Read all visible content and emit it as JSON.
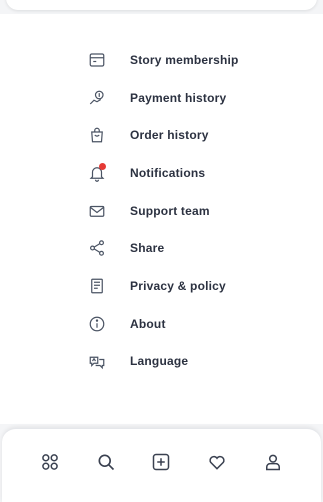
{
  "menu": {
    "items": [
      {
        "label": "Story membership",
        "icon": "membership-card-icon"
      },
      {
        "label": "Payment history",
        "icon": "payment-icon"
      },
      {
        "label": "Order history",
        "icon": "order-bag-icon"
      },
      {
        "label": "Notifications",
        "icon": "bell-icon",
        "badge": true
      },
      {
        "label": "Support team",
        "icon": "mail-icon"
      },
      {
        "label": "Share",
        "icon": "share-icon"
      },
      {
        "label": "Privacy & policy",
        "icon": "document-icon"
      },
      {
        "label": "About",
        "icon": "info-icon"
      },
      {
        "label": "Language",
        "icon": "language-icon"
      }
    ]
  },
  "bottom_nav": {
    "items": [
      "grid-icon",
      "search-icon",
      "add-icon",
      "heart-icon",
      "profile-icon"
    ]
  },
  "colors": {
    "text": "#2b3140",
    "icon": "#4a5363",
    "badge": "#e53935",
    "background": "#ffffff"
  }
}
